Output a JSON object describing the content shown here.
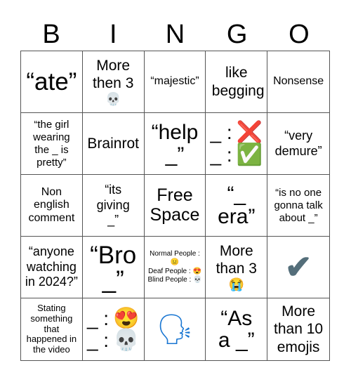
{
  "header": {
    "letters": [
      "B",
      "I",
      "N",
      "G",
      "O"
    ]
  },
  "cells": [
    {
      "text": "“ate”"
    },
    {
      "text": "More then 3",
      "emoji": "💀",
      "emoji_name": "skull"
    },
    {
      "text": "“majestic”"
    },
    {
      "text": "like begging"
    },
    {
      "text": "Nonsense"
    },
    {
      "text": "“the girl wearing the _ is pretty”"
    },
    {
      "text": "Brainrot"
    },
    {
      "text": "“help _”"
    },
    {
      "lines": [
        {
          "label": "_ :",
          "emoji": "❌",
          "emoji_name": "cross-mark"
        },
        {
          "label": "_ :",
          "emoji": "✅",
          "emoji_name": "check-mark-button"
        }
      ]
    },
    {
      "text": "“very demure”"
    },
    {
      "text": "Non english comment"
    },
    {
      "text": "“its giving _”"
    },
    {
      "text": "Free Space"
    },
    {
      "text": "“_ era”"
    },
    {
      "text": "“is no one gonna talk about _”"
    },
    {
      "text": "“anyone watching in 2024?”"
    },
    {
      "text": "“Bro _”"
    },
    {
      "lines": [
        {
          "label": "Normal People :",
          "emoji": "😐"
        },
        {
          "label": "Deaf People :",
          "emoji": "😍"
        },
        {
          "label": "Blind People :",
          "emoji": "💀"
        }
      ]
    },
    {
      "text": "More than 3",
      "emoji": "😭",
      "emoji_name": "loudly-crying-face"
    },
    {
      "emoji": "✔",
      "emoji_name": "check-mark"
    },
    {
      "text": "Stating something that happened in the video"
    },
    {
      "lines": [
        {
          "label": "_ :",
          "emoji": "😍",
          "emoji_name": "heart-eyes"
        },
        {
          "label": "_ :",
          "emoji": "💀",
          "emoji_name": "skull"
        }
      ]
    },
    {
      "emoji": "🗣",
      "emoji_name": "speaking-head"
    },
    {
      "text": "“As a _”"
    },
    {
      "text": "More than 10 emojis"
    }
  ]
}
